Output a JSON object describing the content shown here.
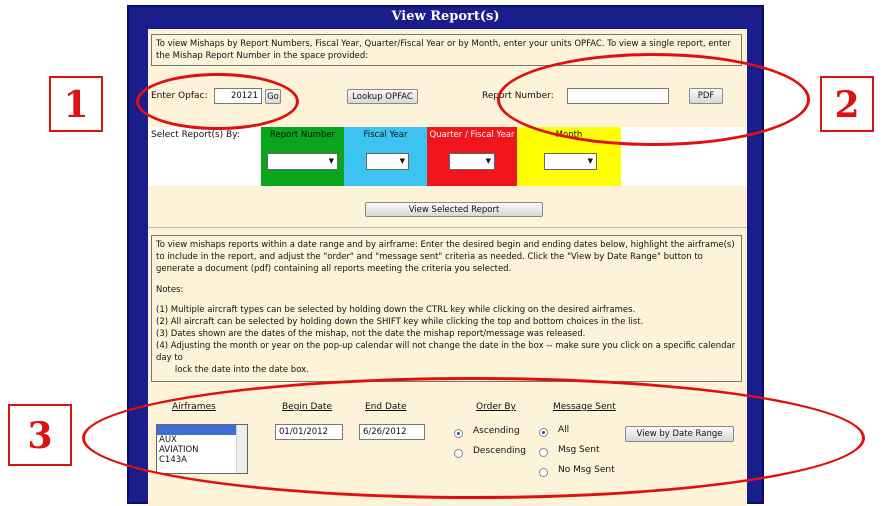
{
  "window": {
    "title": "View Report(s)"
  },
  "top_info": "To view Mishaps by Report Numbers, Fiscal Year, Quarter/Fiscal Year or by Month, enter your units OPFAC. To view a single report, enter the Mishap Report Number in the space provided:",
  "opfac": {
    "label": "Enter Opfac:",
    "value": "20121",
    "go_label": "Go",
    "lookup_label": "Lookup OPFAC"
  },
  "report_number": {
    "label": "Report Number:",
    "value": "",
    "pdf_label": "PDF"
  },
  "select_by": {
    "label": "Select Report(s) By:",
    "options": [
      {
        "label": "Report Number",
        "color": "#0aa51d"
      },
      {
        "label": "Fiscal Year",
        "color": "#3cc3f0"
      },
      {
        "label": "Quarter / Fiscal Year",
        "color": "#f0141c"
      },
      {
        "label": "Month",
        "color": "#ffff00"
      }
    ]
  },
  "view_selected_label": "View Selected Report",
  "date_info": {
    "intro": "To view mishaps reports within a date range and by airframe: Enter the desired begin and ending dates below, highlight the airframe(s) to include in the report, and adjust the \"order\" and \"message sent\" criteria as needed. Click the \"View by Date Range\" button to generate a document (pdf) containing all reports meeting the criteria you selected.",
    "notes_label": "Notes:",
    "notes": [
      "(1)  Multiple aircraft types can be selected by holding down the CTRL key while clicking on the desired airframes.",
      "(2)  All aircraft can be selected by holding down the SHIFT key while clicking the top and bottom choices in the list.",
      "(3)  Dates shown are the dates of the mishap, not the date the mishap report/message was released.",
      "(4)  Adjusting the month or year on the pop-up calendar will not change the date in the box -- make sure you click on a specific calendar day to",
      "       lock the date into the date box."
    ]
  },
  "filters": {
    "airframes_label": "Airframes",
    "airframes": [
      "",
      "AUX",
      "AVIATION",
      "C143A"
    ],
    "begin_label": "Begin Date",
    "begin_value": "01/01/2012",
    "end_label": "End Date",
    "end_value": "6/26/2012",
    "order_label": "Order By",
    "order_options": [
      "Ascending",
      "Descending"
    ],
    "msg_label": "Message Sent",
    "msg_options": [
      "All",
      "Msg Sent",
      "No Msg Sent"
    ],
    "view_range_label": "View by Date Range"
  },
  "callouts": [
    "1",
    "2",
    "3"
  ]
}
